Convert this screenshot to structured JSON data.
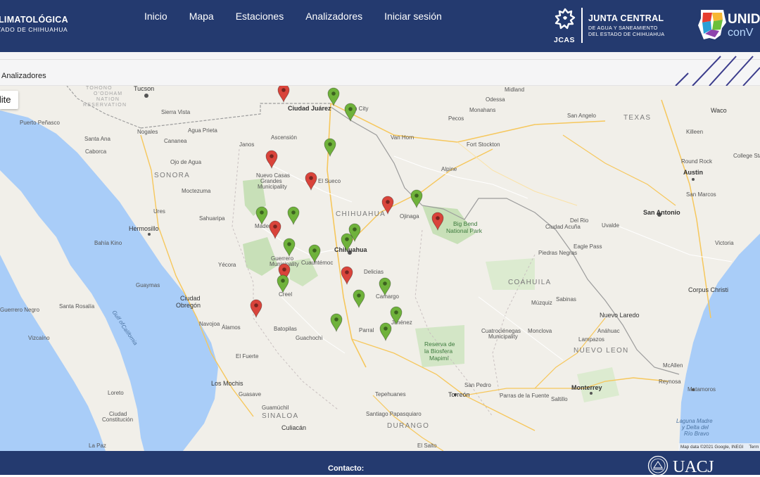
{
  "header": {
    "brand_title": "LIMATOLÓGICA",
    "brand_subtitle": "TADO DE CHIHUAHUA",
    "nav": [
      {
        "label": "Inicio"
      },
      {
        "label": "Mapa"
      },
      {
        "label": "Estaciones"
      },
      {
        "label": "Analizadores"
      },
      {
        "label": "Iniciar sesión"
      }
    ],
    "jcas": {
      "name": "JUNTA CENTRAL",
      "line1": "DE AGUA Y SANEAMIENTO",
      "line2": "DEL ESTADO DE CHIHUAHUA",
      "code": "JCAS"
    },
    "unidos": {
      "word1": "UNID",
      "word2": "conV"
    }
  },
  "breadcrumb": "Analizadores",
  "map": {
    "map_type_button": "llite",
    "attribution": "Map data ©2021 Google, INEGI",
    "terms": "Term",
    "place_labels": {
      "tucson": "Tucson",
      "tohono": "TOHONO",
      "oodham": "O'ODHAM",
      "nation": "NATION",
      "reservation": "RESERVATION",
      "sierra_vista": "Sierra Vista",
      "nogales": "Nogales",
      "cananea": "Cananea",
      "agua_prieta": "Agua Prieta",
      "ciudad_juarez": "Ciudad Juárez",
      "el_paso": "n City",
      "midland": "Midland",
      "odessa": "Odessa",
      "pecos": "Pecos",
      "monahans": "Monahans",
      "van_horn": "Van Horn",
      "fort_stockton": "Fort Stockton",
      "alpine": "Alpine",
      "san_angelo": "San Angelo",
      "texas": "TEXAS",
      "waco": "Waco",
      "killeen": "Killeen",
      "college_station": "College Stati",
      "round_rock": "Round Rock",
      "austin": "Austin",
      "san_marcos": "San Marcos",
      "san_antonio": "San Antonio",
      "victoria": "Victoria",
      "corpus_christi": "Corpus Christi",
      "ciudad_acuna": "Ciudad Acuña",
      "piedras_negras": "Piedras Negras",
      "nuevo_laredo": "Nuevo Laredo",
      "coahuila": "COAHUILA",
      "monclova": "Monclova",
      "nuevo_leon": "NUEVO LEON",
      "monterrey": "Monterrey",
      "saltillo": "Saltillo",
      "reynosa": "Reynosa",
      "mcallen": "McAllen",
      "matamoros": "Matamoros",
      "laguna1": "Laguna Madre",
      "laguna2": "y Delta del",
      "laguna3": "Río Bravo",
      "puerto_penasco": "Puerto Peñasco",
      "caborca": "Caborca",
      "sonora": "SONORA",
      "hermosillo": "Hermosillo",
      "bahia_kino": "Bahía Kino",
      "guaymas": "Guaymas",
      "ciudad_obregon1": "Ciudad",
      "ciudad_obregon2": "Obregón",
      "navojoa": "Navojoa",
      "alamos": "Álamos",
      "los_mochis": "Los Mochis",
      "guasave": "Guasave",
      "guamuchil": "Guamúchil",
      "sinaloa": "SINALOA",
      "culiacan": "Culiacán",
      "durango": "DURANGO",
      "chihuahua_state": "CHIHUAHUA",
      "chihuahua_city": "Chihuahua",
      "cuauhtemoc": "Cuauhtémoc",
      "delicias": "Delicias",
      "camargo": "Camargo",
      "parral": "Parral",
      "jimenez": "Jiménez",
      "ojinaga": "Ojinaga",
      "torreon": "Torreón",
      "san_pedro": "San Pedro",
      "parras": "Parras de la Fuente",
      "santiago": "Santiago Papasquiaro",
      "ncg1": "Nuevo Casas",
      "ncg2": "Grandes",
      "ncg3": "Municipality",
      "guerrero1": "Guerrero",
      "guerrero2": "Municipality",
      "gulf1": "Gulf of",
      "gulf2": "California",
      "big_bend1": "Big Bend",
      "big_bend2": "National Park",
      "biosfera1": "Reserva de",
      "biosfera2": "la Biosfera",
      "biosfera3": "Mapimí",
      "ciudad_constitucion1": "Ciudad",
      "ciudad_constitucion2": "Constitución",
      "loreto": "Loreto",
      "santa_rosalia": "Santa Rosalía",
      "guerrero_negro": "Guerrero Negro",
      "la_paz": "La Paz",
      "vizcaino": "Vizcaíno",
      "santa_ana": "Santa Ana",
      "el_fuerte": "El Fuerte",
      "ojo_de_agua": "Ojo de Agua",
      "ascension": "Ascensión",
      "janos": "Janos",
      "madera": "Madera",
      "el_sueco": "El Sueco",
      "moctezuma": "Moctezuma",
      "ures": "Ures",
      "sahuaripa": "Sahuaripa",
      "yecora": "Yécora",
      "creel": "Creel",
      "guachochi": "Guachochi",
      "batopilas": "Batopilas",
      "tepehuanes": "Tepehuanes",
      "el_salto": "El Salto",
      "cuatrocienegas1": "Cuatrociénegas",
      "cuatrocienegas2": "Municipality",
      "sabinas": "Sabinas",
      "muzquiz": "Múzquiz",
      "lampazos": "Lampazos",
      "anahuac": "Anáhuac",
      "uvalde": "Uvalde",
      "del_rio": "Del Rio",
      "eagle_pass": "Eagle Pass"
    },
    "stations": [
      {
        "status": "offline",
        "color": "#d9443b"
      },
      {
        "status": "online",
        "color": "#6fb23b"
      },
      {
        "status": "online",
        "color": "#6fb23b"
      },
      {
        "status": "offline",
        "color": "#d9443b"
      },
      {
        "status": "online",
        "color": "#6fb23b"
      },
      {
        "status": "offline",
        "color": "#d9443b"
      },
      {
        "status": "offline",
        "color": "#d9443b"
      },
      {
        "status": "online",
        "color": "#6fb23b"
      },
      {
        "status": "offline",
        "color": "#d9443b"
      },
      {
        "status": "online",
        "color": "#6fb23b"
      },
      {
        "status": "online",
        "color": "#6fb23b"
      },
      {
        "status": "offline",
        "color": "#d9443b"
      },
      {
        "status": "online",
        "color": "#6fb23b"
      },
      {
        "status": "online",
        "color": "#6fb23b"
      },
      {
        "status": "online",
        "color": "#6fb23b"
      },
      {
        "status": "online",
        "color": "#6fb23b"
      },
      {
        "status": "offline",
        "color": "#d9443b"
      },
      {
        "status": "offline",
        "color": "#d9443b"
      },
      {
        "status": "online",
        "color": "#6fb23b"
      },
      {
        "status": "online",
        "color": "#6fb23b"
      },
      {
        "status": "online",
        "color": "#6fb23b"
      },
      {
        "status": "offline",
        "color": "#d9443b"
      },
      {
        "status": "online",
        "color": "#6fb23b"
      },
      {
        "status": "online",
        "color": "#6fb23b"
      },
      {
        "status": "online",
        "color": "#6fb23b"
      }
    ]
  },
  "footer": {
    "contact": "Contacto:",
    "uacj": "UACJ"
  },
  "colors": {
    "navy": "#243a6f",
    "online": "#6fb23b",
    "offline": "#d9443b",
    "water": "#a9cdf8"
  }
}
